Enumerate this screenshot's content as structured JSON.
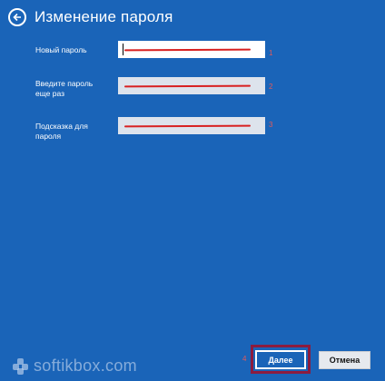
{
  "header": {
    "title": "Изменение пароля",
    "back_icon": "back-arrow-icon"
  },
  "fields": [
    {
      "label": "Новый пароль",
      "marker": "1"
    },
    {
      "label": "Введите пароль\nеще раз",
      "marker": "2"
    },
    {
      "label": "Подсказка для\nпароля",
      "marker": "3"
    }
  ],
  "buttons": {
    "next_label": "Далее",
    "cancel_label": "Отмена",
    "next_marker": "4"
  },
  "watermark": {
    "text": "softikbox.com"
  },
  "colors": {
    "background": "#1a64b8",
    "annotation_red": "#d82020",
    "highlight_frame": "#8b1c3f"
  }
}
